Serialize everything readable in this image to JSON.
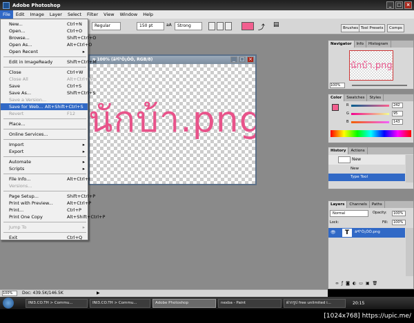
{
  "window": {
    "title": "Adobe Photoshop",
    "controls": [
      "_",
      "□",
      "×"
    ]
  },
  "menubar": [
    "File",
    "Edit",
    "Image",
    "Layer",
    "Select",
    "Filter",
    "View",
    "Window",
    "Help"
  ],
  "options": {
    "font_style": "Regular",
    "font_size": "150 pt",
    "aa_icon": "aA",
    "antialias": "Strong",
    "buttons": [
      "Brushes",
      "Tool Presets",
      "Comps"
    ]
  },
  "file_menu": [
    {
      "label": "New...",
      "shortcut": "Ctrl+N"
    },
    {
      "label": "Open...",
      "shortcut": "Ctrl+O"
    },
    {
      "label": "Browse...",
      "shortcut": "Shift+Ctrl+O"
    },
    {
      "label": "Open As...",
      "shortcut": "Alt+Ctrl+O"
    },
    {
      "label": "Open Recent",
      "shortcut": ""
    },
    {
      "label": "Edit in ImageReady",
      "shortcut": "Shift+Ctrl+M"
    },
    {
      "label": "Close",
      "shortcut": "Ctrl+W"
    },
    {
      "label": "Close All",
      "shortcut": "Alt+Ctrl+W"
    },
    {
      "label": "Save",
      "shortcut": "Ctrl+S"
    },
    {
      "label": "Save As...",
      "shortcut": "Shift+Ctrl+S"
    },
    {
      "label": "Save a Version...",
      "shortcut": ""
    },
    {
      "label": "Save for Web...",
      "shortcut": "Alt+Shift+Ctrl+S"
    },
    {
      "label": "Revert",
      "shortcut": "F12"
    },
    {
      "label": "Place...",
      "shortcut": ""
    },
    {
      "label": "Online Services...",
      "shortcut": ""
    },
    {
      "label": "Import",
      "shortcut": ""
    },
    {
      "label": "Export",
      "shortcut": ""
    },
    {
      "label": "Automate",
      "shortcut": ""
    },
    {
      "label": "Scripts",
      "shortcut": ""
    },
    {
      "label": "File Info...",
      "shortcut": "Alt+Ctrl+I"
    },
    {
      "label": "Versions...",
      "shortcut": ""
    },
    {
      "label": "Page Setup...",
      "shortcut": "Shift+Ctrl+P"
    },
    {
      "label": "Print with Preview...",
      "shortcut": "Alt+Ctrl+P"
    },
    {
      "label": "Print...",
      "shortcut": "Ctrl+P"
    },
    {
      "label": "Print One Copy",
      "shortcut": "Alt+Shift+Ctrl+P"
    },
    {
      "label": "Jump To",
      "shortcut": ""
    },
    {
      "label": "Exit",
      "shortcut": "Ctrl+Q"
    }
  ],
  "document": {
    "title": "p 100% (ãªî¹Ò¡ÒÓ, RGB/8)",
    "text": "นักบ้า.png"
  },
  "navigator": {
    "tabs": [
      "Navigator",
      "Info",
      "Histogram"
    ],
    "zoom": "100%"
  },
  "color": {
    "tabs": [
      "Color",
      "Swatches",
      "Styles"
    ],
    "channels": [
      {
        "label": "R",
        "value": "242"
      },
      {
        "label": "G",
        "value": "95"
      },
      {
        "label": "B",
        "value": "143"
      }
    ],
    "fg": "#f25f8f"
  },
  "history": {
    "tabs": [
      "History",
      "Actions"
    ],
    "items": [
      "New",
      "New",
      "Type Tool"
    ]
  },
  "layers": {
    "tabs": [
      "Layers",
      "Channels",
      "Paths"
    ],
    "blend": "Normal",
    "opacity_label": "Opacity:",
    "opacity": "100%",
    "lock_label": "Lock:",
    "fill_label": "Fill:",
    "fill": "100%",
    "layer_name": "ãªî¹Ò¡ÒÓ.png"
  },
  "statusbar": {
    "zoom": "100%",
    "doc": "Doc: 439.5K/146.5K"
  },
  "taskbar": {
    "tasks": [
      "INI3.CO.TH > Commu...",
      "INI3.CO.TH > Commu...",
      "Adobe Photoshop",
      "nexba - Paint",
      "ฝากรูป free unlimited i..."
    ],
    "time": "20:15"
  },
  "footer": "[1024x768] https://upic.me/"
}
